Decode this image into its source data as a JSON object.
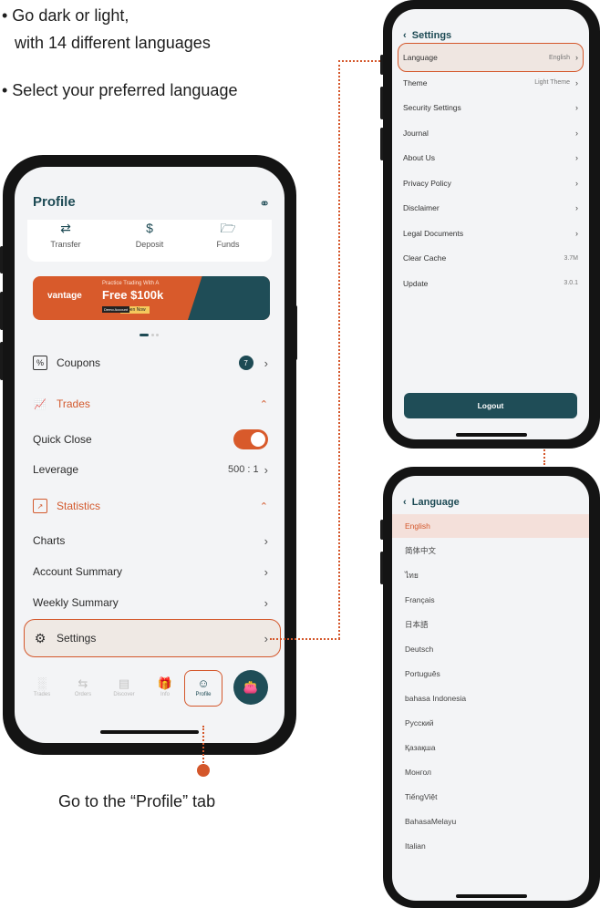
{
  "captions": {
    "bullet1_line1": "•  Go dark or light,",
    "bullet1_line2": "with 14 different languages",
    "bullet2": "•  Select your preferred language",
    "bottom": "Go to the “Profile” tab"
  },
  "profile_screen": {
    "title": "Profile",
    "support_icon": "headset-icon",
    "quick_actions": [
      {
        "label": "Transfer",
        "icon": "transfer-icon"
      },
      {
        "label": "Deposit",
        "icon": "deposit-icon"
      },
      {
        "label": "Funds",
        "icon": "funds-icon"
      }
    ],
    "banner": {
      "brand": "vantage",
      "tagline": "Practice Trading With A",
      "headline": "Free $100k",
      "tag": "Demo Account",
      "cta": "Open Now"
    },
    "coupons": {
      "label": "Coupons",
      "badge": "7"
    },
    "trades_section": "Trades",
    "quick_close": {
      "label": "Quick Close",
      "enabled": true
    },
    "leverage": {
      "label": "Leverage",
      "value": "500 : 1"
    },
    "statistics_section": "Statistics",
    "stats_items": [
      "Charts",
      "Account Summary",
      "Weekly Summary"
    ],
    "settings": "Settings",
    "tabs": [
      {
        "label": "Trades",
        "icon": "chart-bars-icon"
      },
      {
        "label": "Orders",
        "icon": "orders-icon"
      },
      {
        "label": "Discover",
        "icon": "discover-icon"
      },
      {
        "label": "Info",
        "icon": "gift-icon"
      },
      {
        "label": "Profile",
        "icon": "person-icon",
        "active": true
      }
    ]
  },
  "settings_screen": {
    "title": "Settings",
    "items": [
      {
        "label": "Language",
        "value": "English",
        "chevron": true
      },
      {
        "label": "Theme",
        "value": "Light Theme",
        "chevron": true
      },
      {
        "label": "Security Settings",
        "value": "",
        "chevron": true
      },
      {
        "label": "Journal",
        "value": "",
        "chevron": true
      },
      {
        "label": "About Us",
        "value": "",
        "chevron": true
      },
      {
        "label": "Privacy Policy",
        "value": "",
        "chevron": true
      },
      {
        "label": "Disclaimer",
        "value": "",
        "chevron": true
      },
      {
        "label": "Legal Documents",
        "value": "",
        "chevron": true
      },
      {
        "label": "Clear Cache",
        "value": "3.7M",
        "chevron": false
      },
      {
        "label": "Update",
        "value": "3.0.1",
        "chevron": false
      }
    ],
    "logout": "Logout"
  },
  "language_screen": {
    "title": "Language",
    "selected": "English",
    "languages": [
      "English",
      "简体中文",
      "ไทย",
      "Français",
      "日本語",
      "Deutsch",
      "Português",
      "bahasa Indonesia",
      "Русский",
      "Қазақша",
      "Монгол",
      "TiếngViệt",
      "BahasaMelayu",
      "Italian"
    ]
  },
  "colors": {
    "accent": "#d4572b",
    "primary": "#1f4d57"
  }
}
